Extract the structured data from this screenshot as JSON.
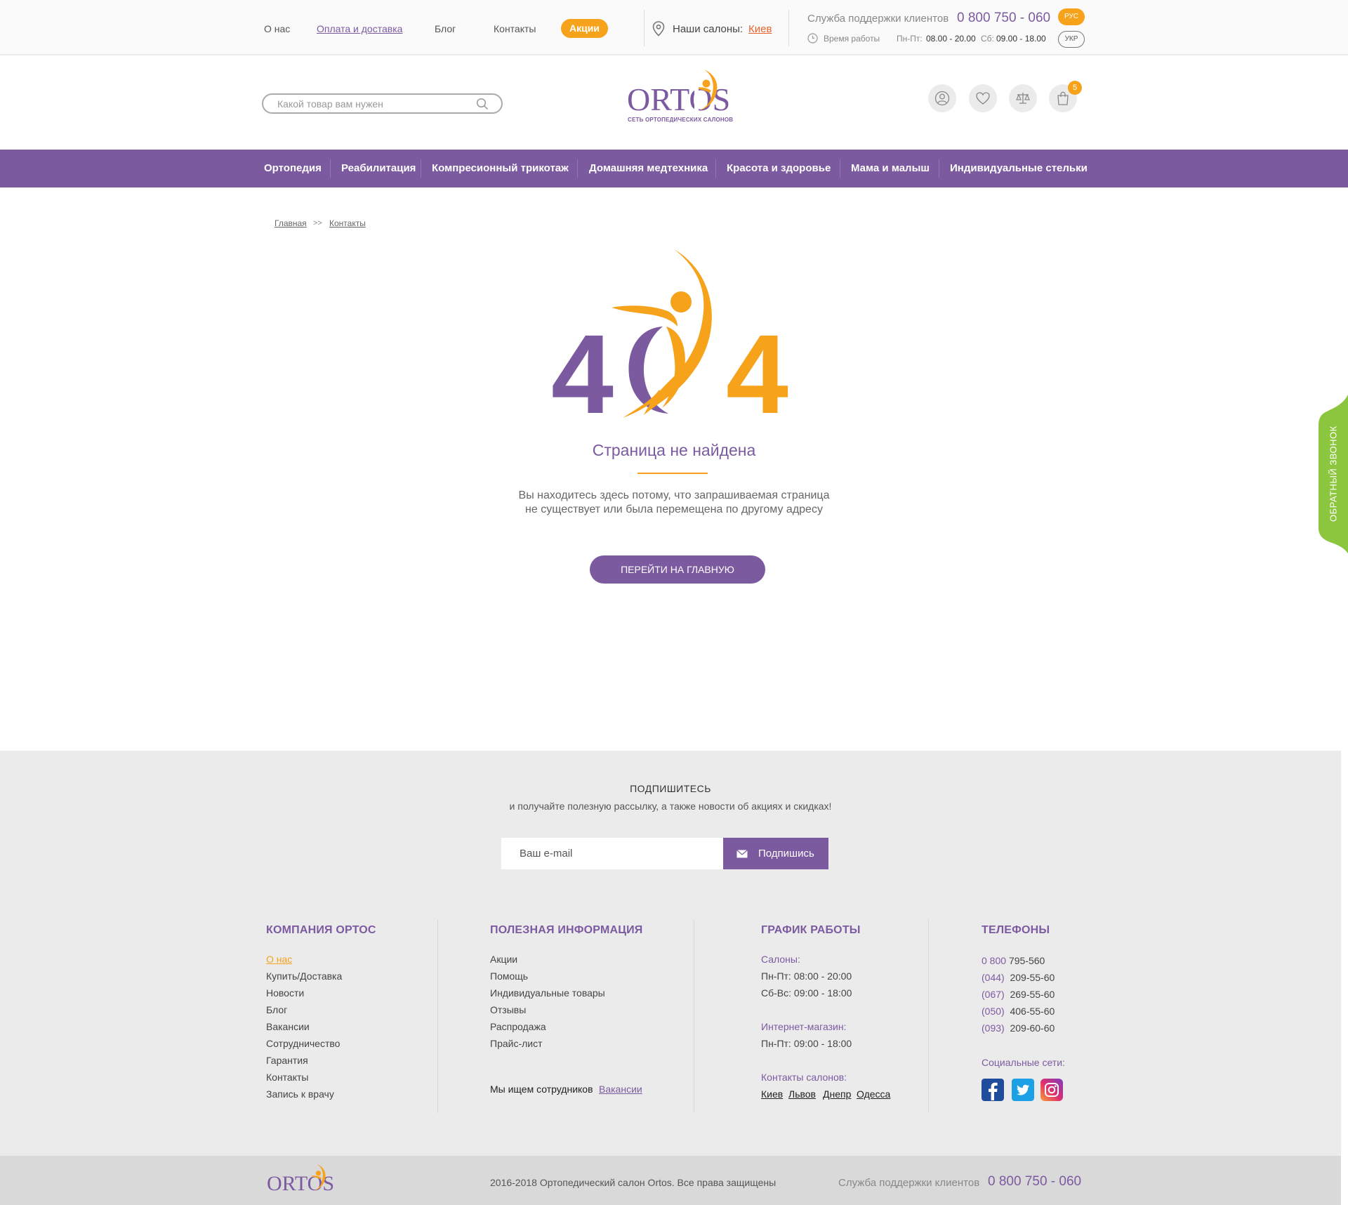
{
  "topbar": {
    "links": [
      "О нас",
      "Оплата и доставка",
      "Блог",
      "Контакты"
    ],
    "promo": "Акции",
    "salons_label": "Наши салоны:",
    "salons_city": "Киев",
    "support_label": "Служба поддержки клиентов",
    "support_phone": "0 800 750 - 060",
    "hours_label": "Время работы",
    "weekdays_label": "Пн-Пт:",
    "weekdays_value": "08.00 - 20.00",
    "saturday_label": "Сб:",
    "saturday_value": "09.00 - 18.00",
    "lang_active": "РУС",
    "lang_other": "УКР"
  },
  "header": {
    "search_placeholder": "Какой товар вам нужен",
    "logo_text": "ORTOS",
    "logo_subtitle": "СЕТЬ ОРТОПЕДИЧЕСКИХ САЛОНОВ",
    "cart_count": "5"
  },
  "nav": {
    "items": [
      "Ортопедия",
      "Реабилитация",
      "Компресионный трикотаж",
      "Домашняя медтехника",
      "Красота и здоровье",
      "Мама и малыш",
      "Индивидуальные стельки"
    ]
  },
  "breadcrumb": {
    "home": "Главная",
    "separator": ">>",
    "current": "Контакты"
  },
  "error": {
    "code_left": "4",
    "code_right": "4",
    "title": "Страница не найдена",
    "text_line1": "Вы находитесь здесь потому, что запрашиваемая страница",
    "text_line2": "не существует или была перемещена по другому адресу",
    "button": "ПЕРЕЙТИ НА ГЛАВНУЮ"
  },
  "callback": {
    "label": "ОБРАТНЫЙ ЗВОНОК"
  },
  "subscribe": {
    "title": "ПОДПИШИТЕСЬ",
    "text": "и получайте полезную рассылку, а также новости об акциях и скидках!",
    "placeholder": "Ваш e-mail",
    "button": "Подпишись"
  },
  "footer": {
    "company": {
      "title": "КОМПАНИЯ ОРТОС",
      "links": [
        "О нас",
        "Купить/Доставка",
        "Новости",
        "Блог",
        "Вакансии",
        "Сотрудничество",
        "Гарантия",
        "Контакты",
        "Запись к врачу"
      ]
    },
    "info": {
      "title": "ПОЛЕЗНАЯ ИНФОРМАЦИЯ",
      "links": [
        "Акции",
        "Помощь",
        "Индивидуальные товары",
        "Отзывы",
        "Распродажа",
        "Прайс-лист"
      ],
      "hiring_text": "Мы ищем сотрудников",
      "hiring_link": "Вакансии"
    },
    "schedule": {
      "title": "ГРАФИК РАБОТЫ",
      "salons_label": "Салоны:",
      "salons_lines": [
        "Пн-Пт: 08:00 - 20:00",
        "Сб-Вс: 09:00 - 18:00"
      ],
      "shop_label": "Интернет-магазин:",
      "shop_lines": [
        "Пн-Пт: 09:00 - 18:00"
      ],
      "contacts_label": "Контакты салонов:",
      "cities": [
        "Киев",
        "Львов",
        "Днепр",
        "Одесса"
      ]
    },
    "phones": {
      "title": "ТЕЛЕФОНЫ",
      "list": [
        {
          "code": "0 800",
          "number": "795-560"
        },
        {
          "code": "(044)",
          "number": "209-55-60"
        },
        {
          "code": "(067)",
          "number": "269-55-60"
        },
        {
          "code": "(050)",
          "number": "406-55-60"
        },
        {
          "code": "(093)",
          "number": "209-60-60"
        }
      ],
      "social_label": "Социальные сети:",
      "social_icons": [
        "facebook-icon",
        "twitter-icon",
        "instagram-icon"
      ]
    }
  },
  "bottombar": {
    "logo_text": "ORTOS",
    "copyright": "2016-2018  Ортопедический салон Ortos. Все права защищены",
    "support_label": "Служба поддержки клиентов",
    "support_phone": "0 800 750 - 060"
  },
  "colors": {
    "brand_purple": "#7c5aa0",
    "brand_orange": "#f7a21b",
    "callback_green": "#8cc63f",
    "footer_bg": "#ebebeb"
  }
}
